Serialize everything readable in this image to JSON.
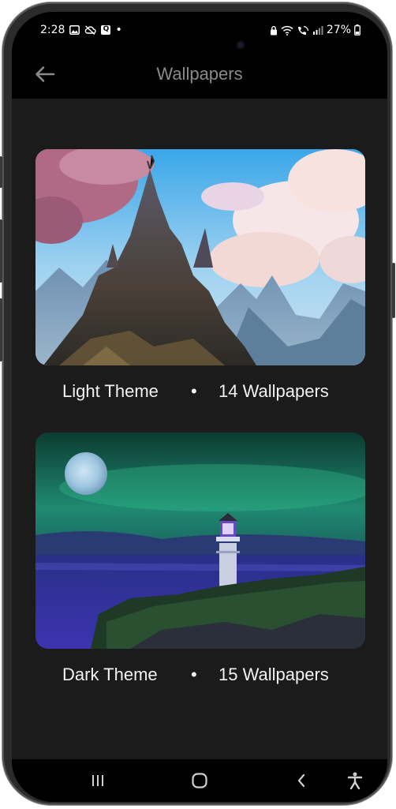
{
  "status_bar": {
    "time": "2:28",
    "battery": "27%",
    "left_icons": [
      "image-icon",
      "cloud-off-icon",
      "q-app-icon",
      "dot-icon"
    ],
    "right_icons": [
      "lock-icon",
      "wifi-icon",
      "wifi-call-icon",
      "signal-icon",
      "battery-icon"
    ]
  },
  "app_bar": {
    "title": "Wallpapers",
    "back_icon": "arrow-left-icon"
  },
  "collections": [
    {
      "name": "Light Theme",
      "separator": "•",
      "count": "14 Wallpapers"
    },
    {
      "name": "Dark Theme",
      "separator": "•",
      "count": "15 Wallpapers"
    }
  ],
  "nav_bar": {
    "items": [
      "recents-icon",
      "home-icon",
      "back-icon",
      "accessibility-icon"
    ]
  },
  "colors": {
    "background": "#1b1b1b",
    "app_bar": "#000000",
    "title": "#8a8a8a",
    "text": "#f2f2f2"
  }
}
